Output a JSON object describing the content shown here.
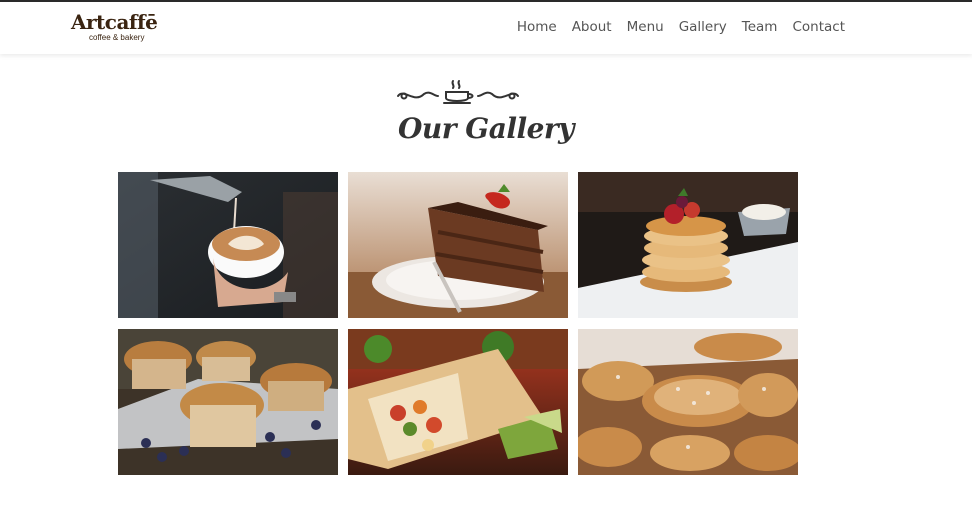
{
  "brand": {
    "name": "Artcaffē",
    "tagline": "coffee & bakery"
  },
  "nav": {
    "items": [
      {
        "label": "Home"
      },
      {
        "label": "About"
      },
      {
        "label": "Menu"
      },
      {
        "label": "Gallery"
      },
      {
        "label": "Team"
      },
      {
        "label": "Contact"
      }
    ]
  },
  "section": {
    "title": "Our Gallery",
    "ornament_icon": "coffee-cup-flourish-icon"
  },
  "gallery": {
    "images": [
      {
        "subject": "latte-art-coffee"
      },
      {
        "subject": "chocolate-cake-strawberry"
      },
      {
        "subject": "pancakes-stack"
      },
      {
        "subject": "blueberry-muffins"
      },
      {
        "subject": "burrito-wraps"
      },
      {
        "subject": "croissants"
      }
    ]
  },
  "colors": {
    "brand": "#3a2411",
    "nav_text": "#555555",
    "title": "#333333"
  }
}
